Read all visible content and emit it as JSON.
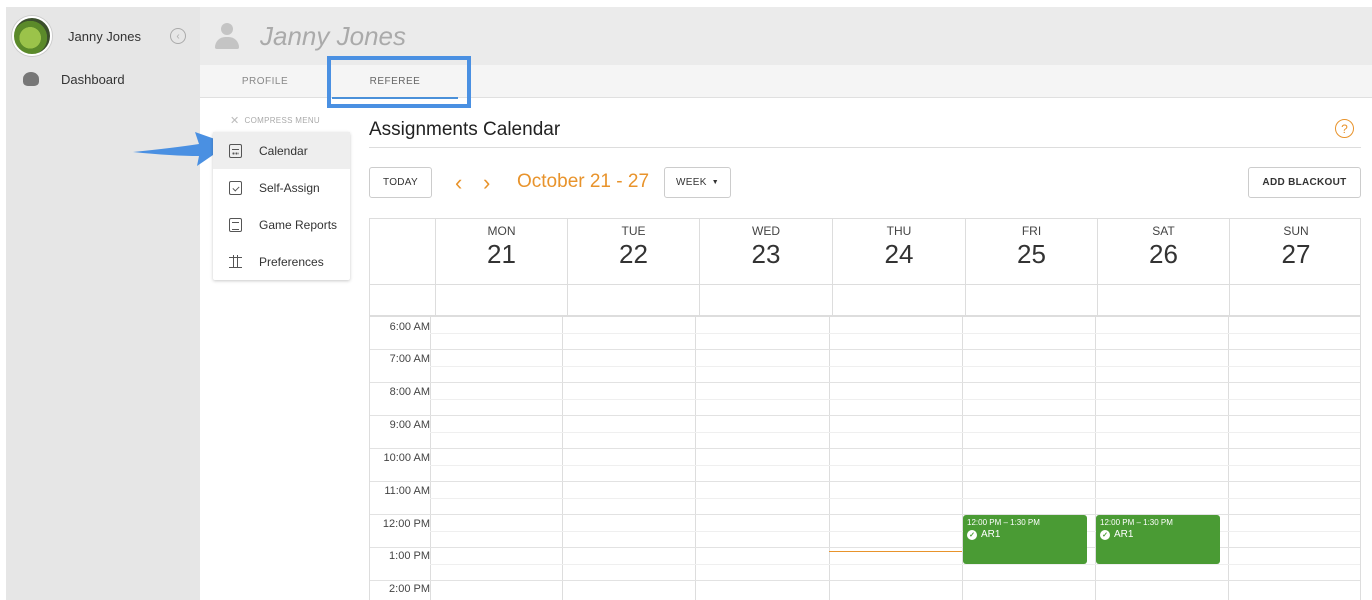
{
  "sidebar": {
    "user_name": "Janny Jones",
    "items": [
      {
        "label": "Dashboard",
        "icon": "dashboard-gauge-icon"
      }
    ]
  },
  "header": {
    "name": "Janny Jones"
  },
  "tabs": [
    {
      "label": "PROFILE",
      "active": false
    },
    {
      "label": "REFEREE",
      "active": true
    }
  ],
  "sub_menu": {
    "header": "COMPRESS MENU",
    "items": [
      {
        "label": "Calendar",
        "icon": "calendar-icon",
        "active": true
      },
      {
        "label": "Self-Assign",
        "icon": "calendar-check-icon",
        "active": false
      },
      {
        "label": "Game Reports",
        "icon": "clipboard-icon",
        "active": false
      },
      {
        "label": "Preferences",
        "icon": "sliders-icon",
        "active": false
      }
    ]
  },
  "calendar": {
    "title": "Assignments Calendar",
    "help": "?",
    "today_label": "TODAY",
    "prev": "‹",
    "next": "›",
    "date_range": "October 21 - 27",
    "view_label": "WEEK",
    "add_blackout_label": "ADD BLACKOUT",
    "days": [
      {
        "name": "MON",
        "num": "21"
      },
      {
        "name": "TUE",
        "num": "22"
      },
      {
        "name": "WED",
        "num": "23"
      },
      {
        "name": "THU",
        "num": "24"
      },
      {
        "name": "FRI",
        "num": "25"
      },
      {
        "name": "SAT",
        "num": "26"
      },
      {
        "name": "SUN",
        "num": "27"
      }
    ],
    "times": [
      "6:00 AM",
      "7:00 AM",
      "8:00 AM",
      "9:00 AM",
      "10:00 AM",
      "11:00 AM",
      "12:00 PM",
      "1:00 PM",
      "2:00 PM"
    ],
    "events": [
      {
        "day": "FRI",
        "time": "12:00 PM – 1:30 PM",
        "role": "AR1"
      },
      {
        "day": "SAT",
        "time": "12:00 PM – 1:30 PM",
        "role": "AR1"
      }
    ]
  },
  "colors": {
    "accent": "#e8932b",
    "event": "#4a9b34",
    "highlight": "#4a90e2"
  }
}
